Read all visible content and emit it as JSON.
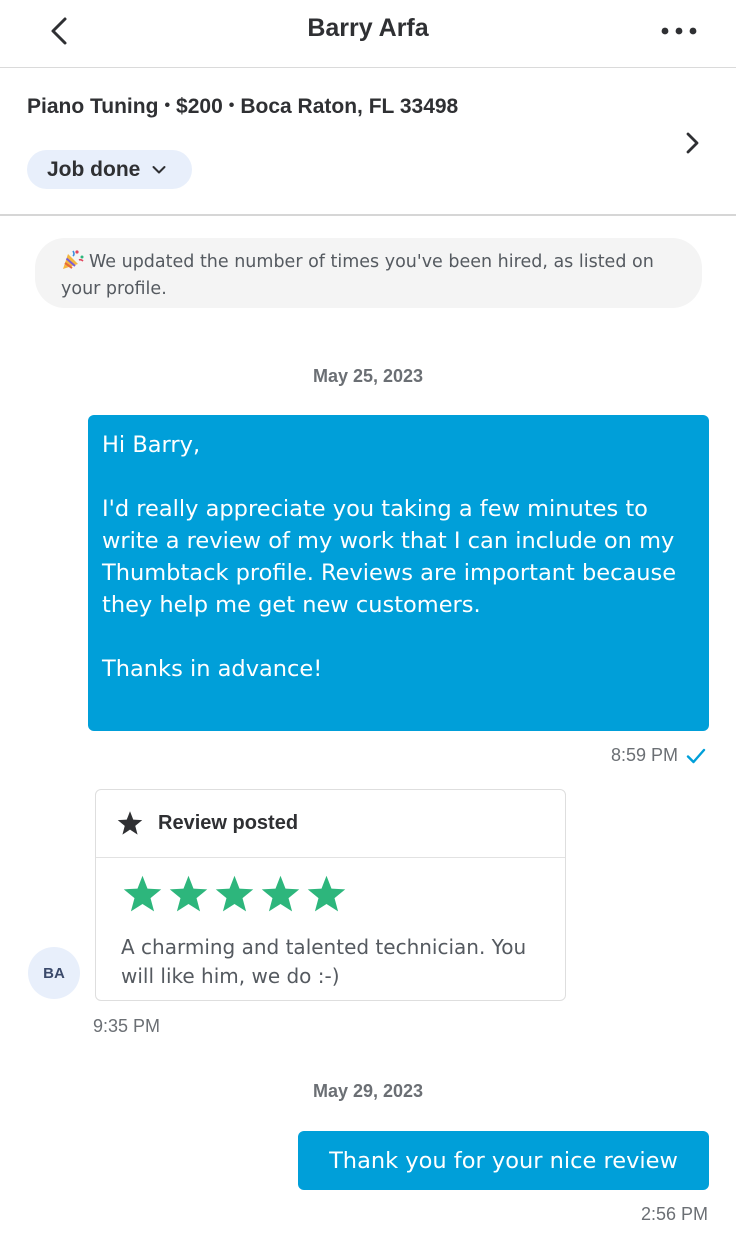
{
  "header": {
    "title": "Barry Arfa",
    "back_icon": "chevron-left-icon",
    "more_icon": "more-horizontal-icon"
  },
  "job": {
    "service": "Piano Tuning",
    "price": "$200",
    "location": "Boca Raton, FL 33498",
    "separator": "•",
    "status_label": "Job done"
  },
  "notice": {
    "icon": "party-popper-icon",
    "text": "We updated the number of times you've been hired, as listed on your profile."
  },
  "thread": {
    "date1": "May 25, 2023",
    "message1": {
      "text": "Hi Barry,\n\nI'd really appreciate you taking a few minutes to write a review of my work that I can include on my Thumbtack profile. Reviews are important because they help me get new customers.\n\nThanks in advance!",
      "time": "8:59 PM",
      "status_icon": "read-check-icon"
    },
    "review": {
      "header_label": "Review posted",
      "rating": 5,
      "rating_max": 5,
      "text": "A charming and talented technician. You will like him, we do :-)",
      "time": "9:35 PM",
      "avatar_initials": "BA"
    },
    "date2": "May 29, 2023",
    "message2": {
      "text": "Thank you for your nice review",
      "time": "2:56 PM"
    }
  },
  "colors": {
    "brand_blue": "#009fd9",
    "star_green": "#2db67c",
    "pill_bg": "#e8effb"
  }
}
